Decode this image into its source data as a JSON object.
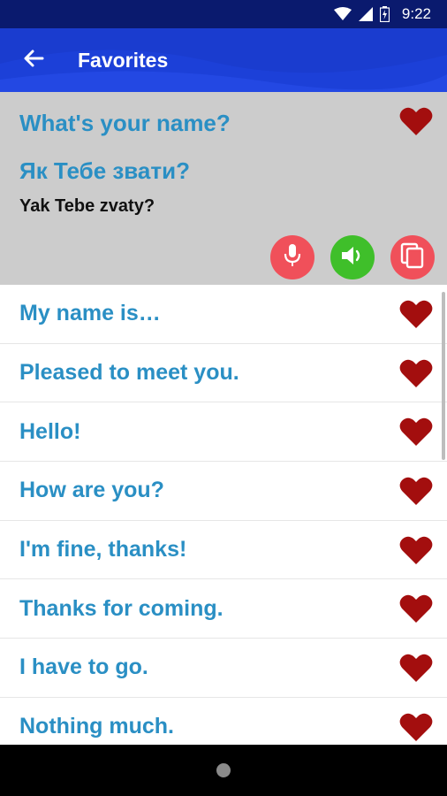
{
  "status_bar": {
    "time": "9:22",
    "icons": [
      "wifi-icon",
      "signal-icon",
      "battery-icon"
    ]
  },
  "app_bar": {
    "title": "Favorites",
    "back_icon": "arrow-left-icon"
  },
  "selected_phrase": {
    "english": "What's your name?",
    "ukrainian": "Як Тебе звати?",
    "transliteration": "Yak Tebe zvaty?",
    "favorite_icon": "heart-icon",
    "actions": [
      "microphone-icon",
      "speaker-icon",
      "copy-icon"
    ]
  },
  "phrases": [
    {
      "text": "My name is…"
    },
    {
      "text": "Pleased to meet you."
    },
    {
      "text": "Hello!"
    },
    {
      "text": "How are you?"
    },
    {
      "text": "I'm fine, thanks!"
    },
    {
      "text": "Thanks for coming."
    },
    {
      "text": "I have to go."
    },
    {
      "text": "Nothing much."
    }
  ],
  "colors": {
    "status_bar": "#0a1a6e",
    "app_bar": "#1a3ccf",
    "phrase_text": "#2a8fc4",
    "heart": "#a30e0e",
    "selected_bg": "#cccccc",
    "mic_button": "#f0505a",
    "speak_button": "#3fbf2a",
    "copy_button": "#f0505a"
  }
}
